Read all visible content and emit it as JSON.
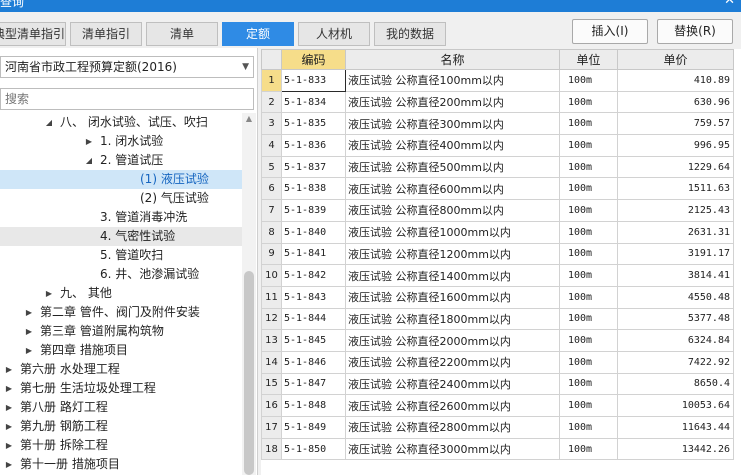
{
  "window": {
    "title": "查询",
    "close_glyph": "✕"
  },
  "tabs": [
    {
      "label": "典型清单指引",
      "active": false
    },
    {
      "label": "清单指引",
      "active": false
    },
    {
      "label": "清单",
      "active": false
    },
    {
      "label": "定额",
      "active": true
    },
    {
      "label": "人材机",
      "active": false
    },
    {
      "label": "我的数据",
      "active": false
    }
  ],
  "buttons": {
    "insert": "插入(I)",
    "replace": "替换(R)"
  },
  "library_select": {
    "value": "河南省市政工程预算定额(2016)"
  },
  "search": {
    "placeholder": "搜索"
  },
  "tree": [
    {
      "indent": 1,
      "toggle": "◢",
      "label": "八、 闭水试验、试压、吹扫",
      "state": ""
    },
    {
      "indent": 2,
      "toggle": "▶",
      "label": "1. 闭水试验",
      "state": ""
    },
    {
      "indent": 2,
      "toggle": "◢",
      "label": "2. 管道试压",
      "state": ""
    },
    {
      "indent": 3,
      "toggle": "",
      "label": "(1) 液压试验",
      "state": "selected"
    },
    {
      "indent": 3,
      "toggle": "",
      "label": "(2) 气压试验",
      "state": ""
    },
    {
      "indent": 2,
      "toggle": "",
      "label": "3. 管道消毒冲洗",
      "state": ""
    },
    {
      "indent": 2,
      "toggle": "",
      "label": "4. 气密性试验",
      "state": "hover"
    },
    {
      "indent": 2,
      "toggle": "",
      "label": "5. 管道吹扫",
      "state": ""
    },
    {
      "indent": 2,
      "toggle": "",
      "label": "6. 井、池渗漏试验",
      "state": ""
    },
    {
      "indent": 1,
      "toggle": "▶",
      "label": "九、 其他",
      "state": ""
    },
    {
      "indent": 0.5,
      "toggle": "▶",
      "label": "第二章 管件、阀门及附件安装",
      "state": ""
    },
    {
      "indent": 0.5,
      "toggle": "▶",
      "label": "第三章 管道附属构筑物",
      "state": ""
    },
    {
      "indent": 0.5,
      "toggle": "▶",
      "label": "第四章 措施项目",
      "state": ""
    },
    {
      "indent": 0,
      "toggle": "▶",
      "label": "第六册 水处理工程",
      "state": ""
    },
    {
      "indent": 0,
      "toggle": "▶",
      "label": "第七册 生活垃圾处理工程",
      "state": ""
    },
    {
      "indent": 0,
      "toggle": "▶",
      "label": "第八册 路灯工程",
      "state": ""
    },
    {
      "indent": 0,
      "toggle": "▶",
      "label": "第九册 钢筋工程",
      "state": ""
    },
    {
      "indent": 0,
      "toggle": "▶",
      "label": "第十册 拆除工程",
      "state": ""
    },
    {
      "indent": 0,
      "toggle": "▶",
      "label": "第十一册 措施项目",
      "state": ""
    }
  ],
  "scrollbar": {
    "up_glyph": "▲"
  },
  "table": {
    "headers": {
      "code": "编码",
      "name": "名称",
      "unit": "单位",
      "price": "单价"
    },
    "rows": [
      {
        "no": "1",
        "code": "5-1-833",
        "name": "液压试验 公称直径100mm以内",
        "unit": "100m",
        "price": "410.89"
      },
      {
        "no": "2",
        "code": "5-1-834",
        "name": "液压试验 公称直径200mm以内",
        "unit": "100m",
        "price": "630.96"
      },
      {
        "no": "3",
        "code": "5-1-835",
        "name": "液压试验 公称直径300mm以内",
        "unit": "100m",
        "price": "759.57"
      },
      {
        "no": "4",
        "code": "5-1-836",
        "name": "液压试验 公称直径400mm以内",
        "unit": "100m",
        "price": "996.95"
      },
      {
        "no": "5",
        "code": "5-1-837",
        "name": "液压试验 公称直径500mm以内",
        "unit": "100m",
        "price": "1229.64"
      },
      {
        "no": "6",
        "code": "5-1-838",
        "name": "液压试验 公称直径600mm以内",
        "unit": "100m",
        "price": "1511.63"
      },
      {
        "no": "7",
        "code": "5-1-839",
        "name": "液压试验 公称直径800mm以内",
        "unit": "100m",
        "price": "2125.43"
      },
      {
        "no": "8",
        "code": "5-1-840",
        "name": "液压试验 公称直径1000mm以内",
        "unit": "100m",
        "price": "2631.31"
      },
      {
        "no": "9",
        "code": "5-1-841",
        "name": "液压试验 公称直径1200mm以内",
        "unit": "100m",
        "price": "3191.17"
      },
      {
        "no": "10",
        "code": "5-1-842",
        "name": "液压试验 公称直径1400mm以内",
        "unit": "100m",
        "price": "3814.41"
      },
      {
        "no": "11",
        "code": "5-1-843",
        "name": "液压试验 公称直径1600mm以内",
        "unit": "100m",
        "price": "4550.48"
      },
      {
        "no": "12",
        "code": "5-1-844",
        "name": "液压试验 公称直径1800mm以内",
        "unit": "100m",
        "price": "5377.48"
      },
      {
        "no": "13",
        "code": "5-1-845",
        "name": "液压试验 公称直径2000mm以内",
        "unit": "100m",
        "price": "6324.84"
      },
      {
        "no": "14",
        "code": "5-1-846",
        "name": "液压试验 公称直径2200mm以内",
        "unit": "100m",
        "price": "7422.92"
      },
      {
        "no": "15",
        "code": "5-1-847",
        "name": "液压试验 公称直径2400mm以内",
        "unit": "100m",
        "price": "8650.4"
      },
      {
        "no": "16",
        "code": "5-1-848",
        "name": "液压试验 公称直径2600mm以内",
        "unit": "100m",
        "price": "10053.64"
      },
      {
        "no": "17",
        "code": "5-1-849",
        "name": "液压试验 公称直径2800mm以内",
        "unit": "100m",
        "price": "11643.44"
      },
      {
        "no": "18",
        "code": "5-1-850",
        "name": "液压试验 公称直径3000mm以内",
        "unit": "100m",
        "price": "13442.26"
      }
    ]
  }
}
